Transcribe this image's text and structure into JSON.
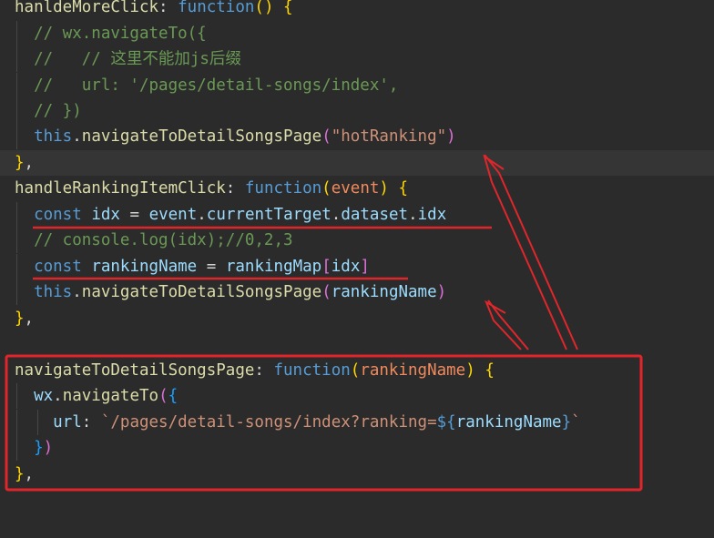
{
  "code_lines": [
    "hanldeMoreClick: function() {",
    "  // wx.navigateTo({",
    "  //   // 这里不能加js后缀",
    "  //   url: '/pages/detail-songs/index',",
    "  // })",
    "  this.navigateToDetailSongsPage(\"hotRanking\")",
    "},",
    "handleRankingItemClick: function(event) {",
    "  const idx = event.currentTarget.dataset.idx",
    "  // console.log(idx);//0,2,3",
    "  const rankingName = rankingMap[idx]",
    "  this.navigateToDetailSongsPage(rankingName)",
    "},",
    "",
    "navigateToDetailSongsPage: function(rankingName) {",
    "  wx.navigateTo({",
    "    url: `/pages/detail-songs/index?ranking=${rankingName}`",
    "  })",
    "},"
  ],
  "colors": {
    "background": "#2b2b2b",
    "annotation_red": "#e0262b",
    "function_name": "#dcdcaa",
    "keyword": "#569cd6",
    "string": "#ce9178",
    "comment": "#6a9955"
  }
}
